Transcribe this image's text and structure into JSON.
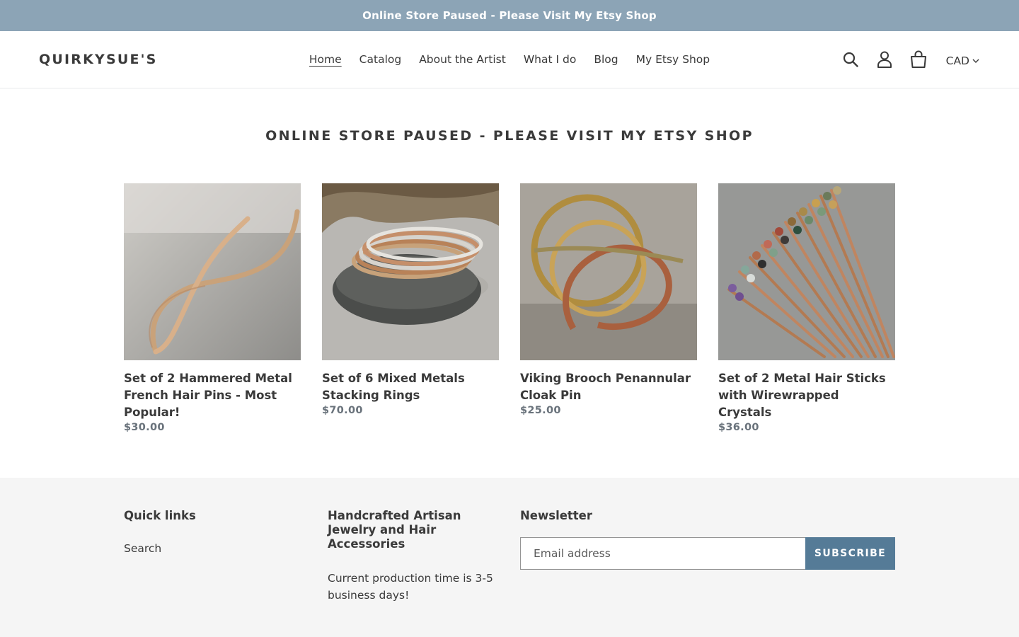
{
  "announcement": {
    "text": "Online Store Paused - Please Visit My Etsy Shop"
  },
  "header": {
    "logo": "QUIRKYSUE'S",
    "nav": [
      {
        "label": "Home",
        "active": true
      },
      {
        "label": "Catalog"
      },
      {
        "label": "About the Artist"
      },
      {
        "label": "What I do"
      },
      {
        "label": "Blog"
      },
      {
        "label": "My Etsy Shop"
      }
    ],
    "icons": [
      "search-icon",
      "account-icon",
      "cart-icon"
    ],
    "currency": "CAD"
  },
  "main": {
    "title": "ONLINE STORE PAUSED - PLEASE VISIT MY ETSY SHOP",
    "products": [
      {
        "title": "Set of 2 Hammered Metal French Hair Pins - Most Popular!",
        "price": "$30.00"
      },
      {
        "title": "Set of 6 Mixed Metals Stacking Rings",
        "price": "$70.00"
      },
      {
        "title": "Viking Brooch Penannular Cloak Pin",
        "price": "$25.00"
      },
      {
        "title": "Set of 2 Metal Hair Sticks with Wirewrapped Crystals",
        "price": "$36.00"
      }
    ]
  },
  "footer": {
    "quick_links": {
      "heading": "Quick links",
      "links": [
        "Search"
      ]
    },
    "about": {
      "heading": "Handcrafted Artisan Jewelry and Hair Accessories",
      "text": "Current production time is 3-5 business days!"
    },
    "newsletter": {
      "heading": "Newsletter",
      "placeholder": "Email address",
      "button": "SUBSCRIBE"
    }
  },
  "colors": {
    "announcement_bg": "#8ca4b6",
    "button_bg": "#557b97",
    "price_text": "#69727b",
    "footer_bg": "#f5f5f5"
  }
}
